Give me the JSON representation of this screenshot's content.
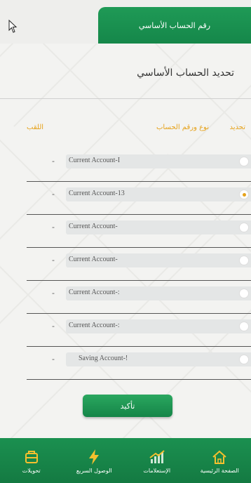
{
  "header": {
    "tab_label": "رقم الحساب الأساسي"
  },
  "section": {
    "title": "تحديد الحساب الأساسي"
  },
  "columns": {
    "select": "تحديد",
    "type": "نوع ورقم الحساب",
    "title": "اللقب"
  },
  "accounts": [
    {
      "name": "Current Account-I",
      "nickname": "-",
      "selected": false
    },
    {
      "name": "Current Account-13",
      "nickname": "-",
      "selected": true
    },
    {
      "name": "Current Account-",
      "nickname": "-",
      "selected": false
    },
    {
      "name": "Current Account-",
      "nickname": "-",
      "selected": false
    },
    {
      "name": "Current Account-:",
      "nickname": "-",
      "selected": false
    },
    {
      "name": "Current Account-:",
      "nickname": "-",
      "selected": false
    },
    {
      "name": "Saving Account-!",
      "nickname": "-",
      "selected": false
    }
  ],
  "confirm_button": "تأكيد",
  "bottom_nav": [
    {
      "label": "الصفحة الرئيسية",
      "icon": "home-icon"
    },
    {
      "label": "الإستعلامات",
      "icon": "chart-icon"
    },
    {
      "label": "الوصول السريع",
      "icon": "lightning-icon"
    },
    {
      "label": "تحويلات",
      "icon": "transfer-icon"
    }
  ],
  "colors": {
    "primary_green": "#15874a",
    "accent_orange": "#e6a21a"
  }
}
